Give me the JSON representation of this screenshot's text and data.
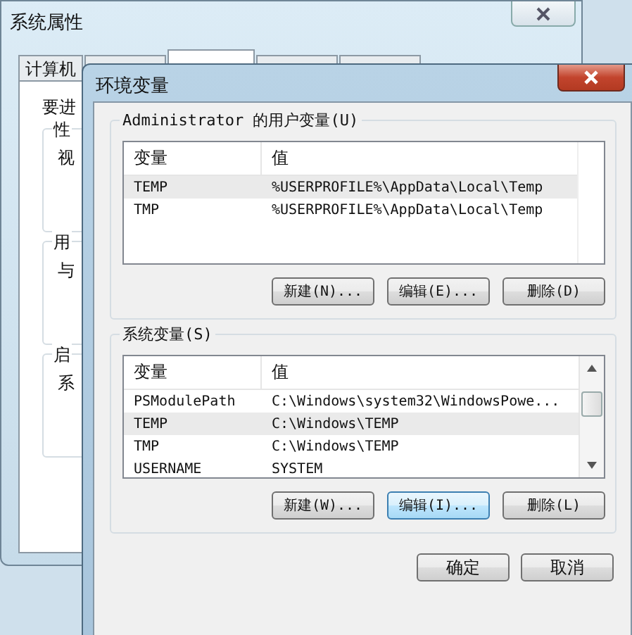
{
  "back_window": {
    "title": "系统属性",
    "tabs": [
      {
        "label": "计算机",
        "selected": false
      },
      {
        "selected": false
      },
      {
        "selected": true
      },
      {
        "selected": false
      },
      {
        "selected": false
      }
    ],
    "intro": "要进",
    "groups": [
      {
        "label": "性",
        "text": "视"
      },
      {
        "label": "用",
        "text": "与"
      },
      {
        "label": "启",
        "text": "系"
      }
    ]
  },
  "dialog": {
    "title": "环境变量",
    "user_vars": {
      "label": "Administrator 的用户变量(U)",
      "columns": [
        "变量",
        "值"
      ],
      "rows": [
        {
          "name": "TEMP",
          "value": "%USERPROFILE%\\AppData\\Local\\Temp",
          "selected": true
        },
        {
          "name": "TMP",
          "value": "%USERPROFILE%\\AppData\\Local\\Temp",
          "selected": false
        }
      ],
      "buttons": [
        {
          "label": "新建(N)...",
          "focused": false
        },
        {
          "label": "编辑(E)...",
          "focused": false
        },
        {
          "label": "删除(D)",
          "focused": false
        }
      ]
    },
    "system_vars": {
      "label": "系统变量(S)",
      "columns": [
        "变量",
        "值"
      ],
      "rows": [
        {
          "name": "PSModulePath",
          "value": "C:\\Windows\\system32\\WindowsPowe...",
          "selected": false
        },
        {
          "name": "TEMP",
          "value": "C:\\Windows\\TEMP",
          "selected": true
        },
        {
          "name": "TMP",
          "value": "C:\\Windows\\TEMP",
          "selected": false
        },
        {
          "name": "USERNAME",
          "value": "SYSTEM",
          "selected": false
        }
      ],
      "buttons": [
        {
          "label": "新建(W)...",
          "focused": false
        },
        {
          "label": "编辑(I)...",
          "focused": true
        },
        {
          "label": "删除(L)",
          "focused": false
        }
      ]
    },
    "buttons": [
      {
        "label": "确定",
        "focused": false
      },
      {
        "label": "取消",
        "focused": false
      }
    ]
  }
}
